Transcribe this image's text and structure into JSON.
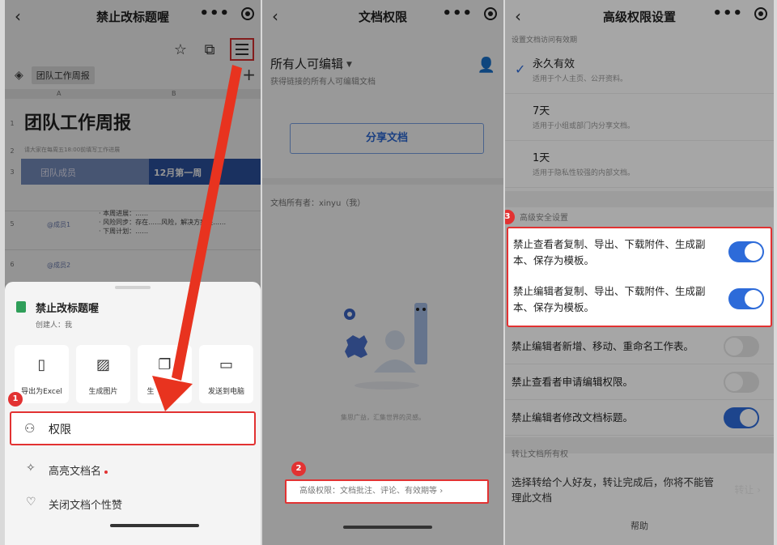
{
  "panel1": {
    "title": "禁止改标题喔",
    "sheet": {
      "tab": "团队工作周报",
      "col_a": "A",
      "col_b": "B",
      "rows": [
        "1",
        "2",
        "3",
        "5",
        "6"
      ],
      "big_title": "团队工作周报",
      "note": "请大家在每周五18:00前填写工作进展",
      "header_member": "团队成员",
      "header_week": "12月第一周",
      "member1": "@成员1",
      "member2": "@成员2",
      "progress_lines": [
        "· 本周进展：……",
        "· 风险同步：存在……风险，解决方案是……",
        "· 下周计划：……"
      ]
    },
    "popup": {
      "doc_name": "禁止改标题喔",
      "creator": "创建人：我",
      "actions": [
        {
          "label": "导出为Excel",
          "icon": "x-file-icon"
        },
        {
          "label": "生成图片",
          "icon": "image-icon"
        },
        {
          "label": "生成副本",
          "icon": "copy-icon"
        },
        {
          "label": "发送到电脑",
          "icon": "monitor-icon"
        }
      ],
      "action3_visible": "生",
      "action3_tail": "本",
      "permission": "权限",
      "highlight_name": "高亮文档名",
      "close_likes": "关闭文档个性赞"
    },
    "step": "1"
  },
  "panel2": {
    "title": "文档权限",
    "mode": "所有人可编辑",
    "mode_desc": "获得链接的所有人可编辑文档",
    "share": "分享文档",
    "owner": "文档所有者：xinyu（我）",
    "slogan": "集思广益，汇集世界的灵感。",
    "advanced": "高级权限：文档批注、评论、有效期等",
    "step": "2"
  },
  "panel3": {
    "title": "高级权限设置",
    "cut_header": "设置文档访问有效期",
    "validity_options": [
      {
        "title": "永久有效",
        "desc": "适用于个人主页、公开资料。",
        "checked": true
      },
      {
        "title": "7天",
        "desc": "适用于小组或部门内分享文档。",
        "checked": false
      },
      {
        "title": "1天",
        "desc": "适用于隐私性较强的内部文档。",
        "checked": false
      }
    ],
    "security_header": "高级安全设置",
    "toggles": [
      {
        "label": "禁止查看者复制、导出、下载附件、生成副本、保存为模板。",
        "on": true
      },
      {
        "label": "禁止编辑者复制、导出、下载附件、生成副本、保存为模板。",
        "on": true
      },
      {
        "label": "禁止编辑者新增、移动、重命名工作表。",
        "on": false
      },
      {
        "label": "禁止查看者申请编辑权限。",
        "on": false
      },
      {
        "label": "禁止编辑者修改文档标题。",
        "on": true
      }
    ],
    "transfer_header": "转让文档所有权",
    "transfer_text": "选择转给个人好友，转让完成后，你将不能管理此文档",
    "transfer_btn": "转让 ›",
    "help": "帮助",
    "step": "3"
  },
  "colors": {
    "accent": "#2d6bd9",
    "highlight": "#e23232",
    "sheet_green": "#2f9e59"
  }
}
